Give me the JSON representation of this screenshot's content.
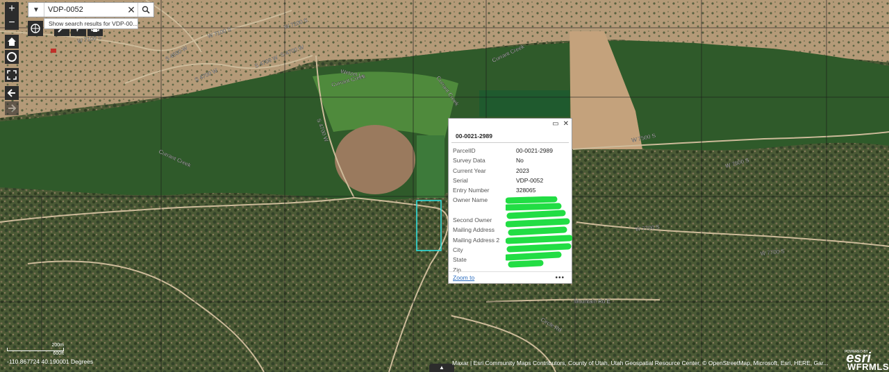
{
  "search": {
    "value": "VDP-0052",
    "suggestion": "Show search results for VDP-00..."
  },
  "controls": {
    "zoom_in": "+",
    "zoom_out": "−"
  },
  "road_labels": [
    "W 7100 S",
    "W 7100 S",
    "W 7100 S",
    "S 4500 W",
    "S 4700 W",
    "S 4700 W",
    "S 4700 W",
    "Wetzel Ln",
    "Currant Creek",
    "Currant Creek",
    "Currant Creek",
    "Currant Creek",
    "S 4700 W",
    "W 7500 S",
    "W 7500 S",
    "W 7700 S",
    "W 7700 S",
    "Mountain Rd E",
    "Circle Rd"
  ],
  "popup": {
    "title": "00-0021-2989",
    "rows": [
      {
        "key": "ParcelID",
        "value": "00-0021-2989"
      },
      {
        "key": "Survey Data",
        "value": "No"
      },
      {
        "key": "Current Year",
        "value": "2023"
      },
      {
        "key": "Serial",
        "value": "VDP-0052"
      },
      {
        "key": "Entry Number",
        "value": "328065"
      },
      {
        "key": "Owner Name",
        "value": ""
      },
      {
        "key": "",
        "value": ""
      },
      {
        "key": "Second Owner",
        "value": ""
      },
      {
        "key": "Mailing Address",
        "value": ""
      },
      {
        "key": "Mailing Address 2",
        "value": ""
      },
      {
        "key": "City",
        "value": ""
      },
      {
        "key": "State",
        "value": ""
      },
      {
        "key": "Zip",
        "value": ""
      }
    ],
    "zoom_to": "Zoom to",
    "more": "•••"
  },
  "footer": {
    "coordinates": "-110.867724 40.190001 Degrees",
    "scale_label_top": "200m",
    "scale_label_bottom": "600ft",
    "attribution": "Maxar | Esri Community Maps Contributors, County of Utah, Utah Geospatial Resource Center, © OpenStreetMap, Microsoft, Esri, HERE, Gar...",
    "powered_by": "POWERED BY",
    "esri_logo": "esri",
    "watermark": "WFRMLS"
  },
  "colors": {
    "parcel_outline": "#2ee6e6",
    "control_bg": "#2c2c2c",
    "link": "#2a6dbf",
    "redaction": "#22dd44"
  }
}
